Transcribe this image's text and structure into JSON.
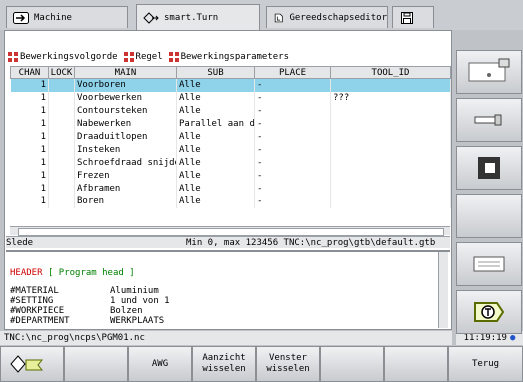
{
  "tabs": [
    {
      "label": "Machine",
      "icon": "arrow-right-icon"
    },
    {
      "label": "smart.Turn",
      "icon": "diamond-arrow-icon"
    },
    {
      "label": "Gereedschapseditor",
      "icon": "document-icon"
    },
    {
      "label": "",
      "icon": "save-disk-icon"
    }
  ],
  "subtabs": [
    "Bewerkingsvolgorde",
    "Regel",
    "Bewerkingsparameters"
  ],
  "table": {
    "headers": [
      "CHAN",
      "LOCK",
      "MAIN",
      "SUB",
      "PLACE",
      "TOOL_ID"
    ],
    "rows": [
      {
        "chan": "1",
        "lock": "",
        "main": "Voorboren",
        "sub": "Alle",
        "place": "-",
        "tool": ""
      },
      {
        "chan": "1",
        "lock": "",
        "main": "Voorbewerken",
        "sub": "Alle",
        "place": "-",
        "tool": "???"
      },
      {
        "chan": "1",
        "lock": "",
        "main": "Contoursteken",
        "sub": "Alle",
        "place": "-",
        "tool": ""
      },
      {
        "chan": "1",
        "lock": "",
        "main": "Nabewerken",
        "sub": "Parallel aan d…",
        "place": "-",
        "tool": ""
      },
      {
        "chan": "1",
        "lock": "",
        "main": "Draaduitlopen",
        "sub": "Alle",
        "place": "-",
        "tool": ""
      },
      {
        "chan": "1",
        "lock": "",
        "main": "Insteken",
        "sub": "Alle",
        "place": "-",
        "tool": ""
      },
      {
        "chan": "1",
        "lock": "",
        "main": "Schroefdraad snijden",
        "sub": "Alle",
        "place": "-",
        "tool": ""
      },
      {
        "chan": "1",
        "lock": "",
        "main": "Frezen",
        "sub": "Alle",
        "place": "-",
        "tool": ""
      },
      {
        "chan": "1",
        "lock": "",
        "main": "Afbramen",
        "sub": "Alle",
        "place": "-",
        "tool": ""
      },
      {
        "chan": "1",
        "lock": "",
        "main": "Boren",
        "sub": "Alle",
        "place": "-",
        "tool": ""
      }
    ]
  },
  "status": {
    "left": "Slede",
    "right": "Min 0, max 123456  TNC:\\nc_prog\\gtb\\default.gtb"
  },
  "editor": {
    "header_kw": "HEADER",
    "header_comment": "[ Program head ]",
    "lines": [
      {
        "key": "#MATERIAL",
        "val": "Aluminium"
      },
      {
        "key": "#SETTING",
        "val": "1 und  von 1"
      },
      {
        "key": "#WORKPIECE",
        "val": "Bolzen"
      },
      {
        "key": "#DEPARTMENT",
        "val": "WERKPLAATS"
      }
    ]
  },
  "path": "TNC:\\nc_prog\\ncps\\PGM01.nc",
  "clock": "11:19:19",
  "bottom_keys": [
    "",
    "",
    "AWG",
    "Aanzicht\nwisselen",
    "Venster\nwisselen",
    "",
    "",
    "Terug"
  ],
  "colors": {
    "selection": "#8fd3ea",
    "header_kw": "#cc0000",
    "comment": "#008000"
  }
}
